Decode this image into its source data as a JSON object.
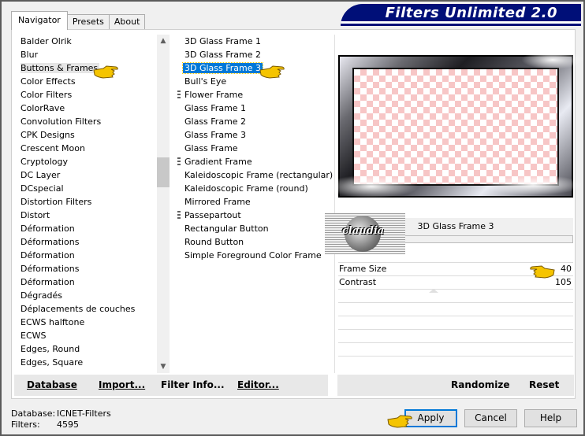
{
  "window": {
    "title_banner": "Filters Unlimited 2.0"
  },
  "tabs": [
    {
      "label": "Navigator",
      "active": true
    },
    {
      "label": "Presets",
      "active": false
    },
    {
      "label": "About",
      "active": false
    }
  ],
  "categories": [
    "Balder Olrik",
    "Blur",
    "Buttons & Frames",
    "Color Effects",
    "Color Filters",
    "ColorRave",
    "Convolution Filters",
    "CPK Designs",
    "Crescent Moon",
    "Cryptology",
    "DC Layer",
    "DCspecial",
    "Distortion Filters",
    "Distort",
    "Déformation",
    "Déformations",
    "Déformation",
    "Déformations",
    "Déformation",
    "Dégradés",
    "Déplacements de couches",
    "ECWS halftone",
    "ECWS",
    "Edges, Round",
    "Edges, Square"
  ],
  "selected_category": "Buttons & Frames",
  "filters": [
    {
      "label": "3D Glass Frame 1",
      "marker": false
    },
    {
      "label": "3D Glass Frame 2",
      "marker": false
    },
    {
      "label": "3D Glass Frame 3",
      "marker": false,
      "selected": true
    },
    {
      "label": "Bull's Eye",
      "marker": false
    },
    {
      "label": "Flower Frame",
      "marker": true
    },
    {
      "label": "Glass Frame 1",
      "marker": false
    },
    {
      "label": "Glass Frame 2",
      "marker": false
    },
    {
      "label": "Glass Frame 3",
      "marker": false
    },
    {
      "label": "Glass Frame",
      "marker": false
    },
    {
      "label": "Gradient Frame",
      "marker": true
    },
    {
      "label": "Kaleidoscopic Frame (rectangular)",
      "marker": false
    },
    {
      "label": "Kaleidoscopic Frame (round)",
      "marker": false
    },
    {
      "label": "Mirrored Frame",
      "marker": false
    },
    {
      "label": "Passepartout",
      "marker": true
    },
    {
      "label": "Rectangular Button",
      "marker": false
    },
    {
      "label": "Round Button",
      "marker": false
    },
    {
      "label": "Simple Foreground Color Frame",
      "marker": false
    }
  ],
  "preview": {
    "filter_name": "3D Glass Frame 3",
    "watermark": "claudia"
  },
  "parameters": [
    {
      "label": "Frame Size",
      "value": "40"
    },
    {
      "label": "Contrast",
      "value": "105"
    }
  ],
  "toolbar_left": [
    {
      "label": "Database"
    },
    {
      "label": "Import..."
    },
    {
      "label": "Filter Info..."
    },
    {
      "label": "Editor..."
    }
  ],
  "toolbar_right": [
    {
      "label": "Randomize"
    },
    {
      "label": "Reset"
    }
  ],
  "status": {
    "database_label": "Database:",
    "database_value": "ICNET-Filters",
    "filters_label": "Filters:",
    "filters_value": "4595"
  },
  "buttons": {
    "apply": "Apply",
    "cancel": "Cancel",
    "help": "Help"
  },
  "colors": {
    "accent": "#0078d7",
    "banner": "#000f78",
    "checker": "#f7c6c6",
    "hand": "#f5c400"
  }
}
